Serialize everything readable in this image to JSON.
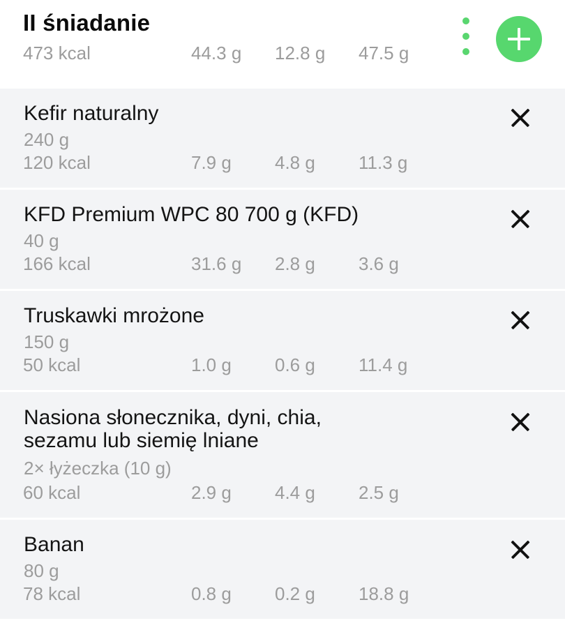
{
  "meal": {
    "title": "II śniadanie",
    "kcal": "473 kcal",
    "protein": "44.3 g",
    "fat": "12.8 g",
    "carbs": "47.5 g"
  },
  "icons": {
    "menu": "more-vert-icon",
    "add": "plus-icon",
    "remove": "close-icon"
  },
  "colors": {
    "accent": "#57d76e",
    "item_background": "#f3f4f6",
    "muted_text": "#9c9c9c"
  },
  "items": [
    {
      "name": "Kefir naturalny",
      "amount": "240 g",
      "kcal": "120 kcal",
      "protein": "7.9 g",
      "fat": "4.8 g",
      "carbs": "11.3 g"
    },
    {
      "name": "KFD Premium WPC 80 700 g (KFD)",
      "amount": "40 g",
      "kcal": "166 kcal",
      "protein": "31.6 g",
      "fat": "2.8 g",
      "carbs": "3.6 g"
    },
    {
      "name": "Truskawki mrożone",
      "amount": "150 g",
      "kcal": "50 kcal",
      "protein": "1.0 g",
      "fat": "0.6 g",
      "carbs": "11.4 g"
    },
    {
      "name_line1": "Nasiona słonecznika, dyni, chia,",
      "name_line2": "sezamu lub siemię lniane",
      "amount": "2× łyżeczka (10 g)",
      "kcal": "60 kcal",
      "protein": "2.9 g",
      "fat": "4.4 g",
      "carbs": "2.5 g"
    },
    {
      "name": "Banan",
      "amount": "80 g",
      "kcal": "78 kcal",
      "protein": "0.8 g",
      "fat": "0.2 g",
      "carbs": "18.8 g"
    }
  ]
}
